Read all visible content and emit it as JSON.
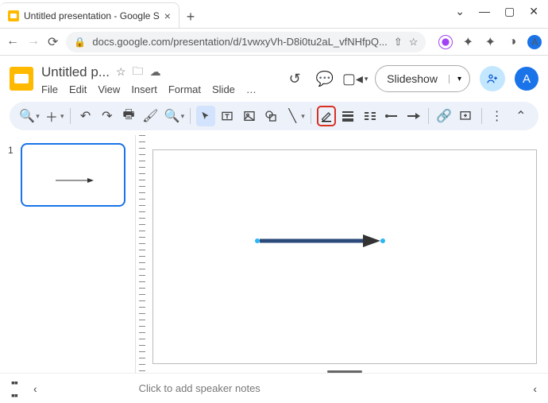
{
  "browser": {
    "tab_title": "Untitled presentation - Google S",
    "url": "docs.google.com/presentation/d/1vwxyVh-D8i0tu2aL_vfNHfpQ...",
    "avatar_letter": "A"
  },
  "header": {
    "doc_title": "Untitled p...",
    "menus": [
      "File",
      "Edit",
      "View",
      "Insert",
      "Format",
      "Slide",
      "…"
    ],
    "slideshow_label": "Slideshow",
    "avatar_letter": "A"
  },
  "thumbnails": {
    "slides": [
      {
        "number": "1"
      }
    ]
  },
  "notes_placeholder": "Click to add speaker notes",
  "colors": {
    "selection": "#1a73e8",
    "highlight": "#d93025"
  }
}
